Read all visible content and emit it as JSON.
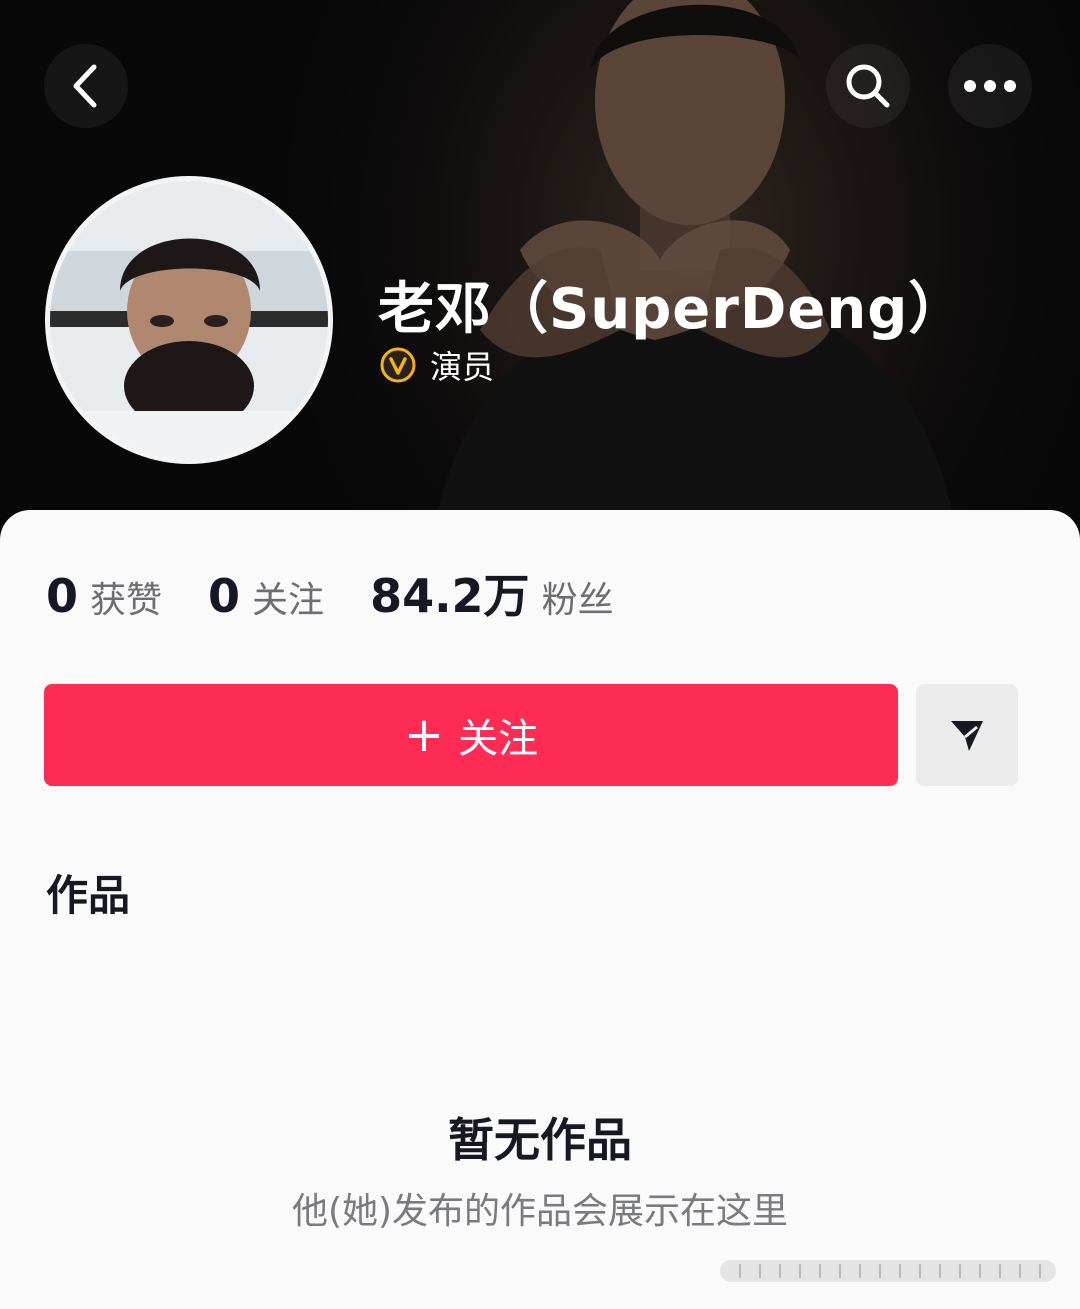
{
  "profile": {
    "name": "老邓（SuperDeng）",
    "verified_title": "演员"
  },
  "stats": [
    {
      "value": "0",
      "label": "获赞"
    },
    {
      "value": "0",
      "label": "关注"
    },
    {
      "value": "84.2万",
      "label": "粉丝"
    }
  ],
  "actions": {
    "follow_plus": "+",
    "follow_label": "关注"
  },
  "tabs": {
    "works": "作品"
  },
  "empty_state": {
    "title": "暂无作品",
    "subtitle": "他(她)发布的作品会展示在这里"
  },
  "colors": {
    "accent": "#fe2c55",
    "badge": "#f5b21b",
    "text_primary": "#161823",
    "text_secondary": "#6d6e73"
  },
  "icons": [
    "back-arrow-icon",
    "search-icon",
    "more-icon",
    "verified-badge-icon",
    "share-send-icon"
  ]
}
